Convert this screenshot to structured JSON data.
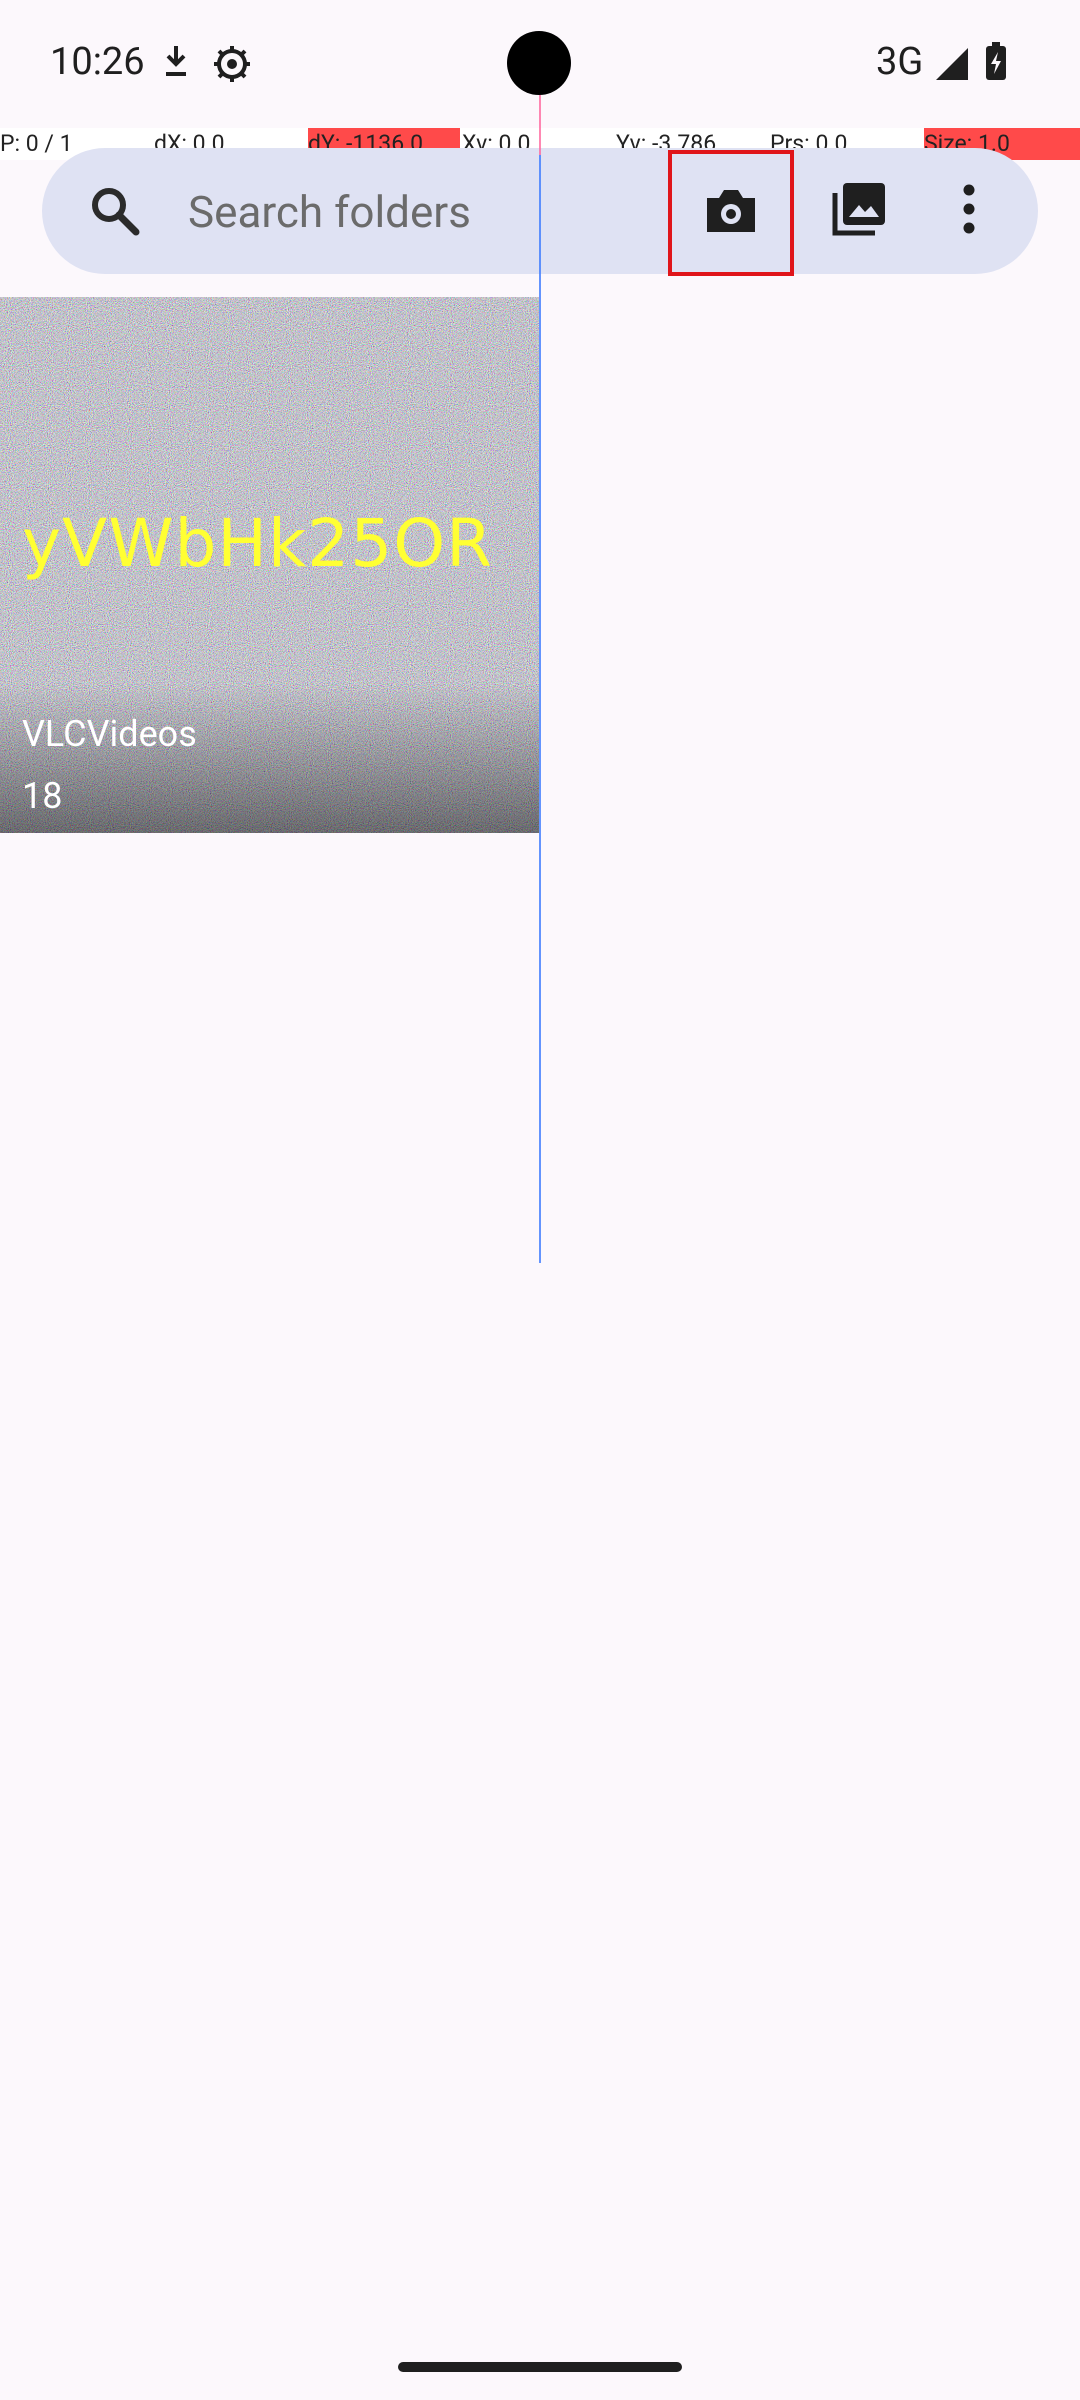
{
  "status_bar": {
    "time": "10:26",
    "network": "3G",
    "icons": [
      "download-icon",
      "settings-icon",
      "signal-icon",
      "battery-charging-icon"
    ]
  },
  "debug_bar": {
    "p": "P: 0 / 1",
    "dx": "dX: 0.0",
    "dy": "dY: -1136.0",
    "xv": "Xv: 0.0",
    "yv": "Yv: -3.786",
    "prs": "Prs: 0.0",
    "size": "Size: 1.0"
  },
  "search": {
    "placeholder": "Search folders"
  },
  "toolbar": {
    "icons": [
      "search-icon",
      "camera-icon",
      "gallery-icon",
      "more-vert-icon"
    ]
  },
  "folders": [
    {
      "name": "VLCVideos",
      "count": "18",
      "thumbnail_text": "yVWbHk25OR"
    }
  ],
  "colors": {
    "background": "#fcf8fc",
    "search_bar": "#dfe2f3",
    "highlight": "#e0151a"
  }
}
